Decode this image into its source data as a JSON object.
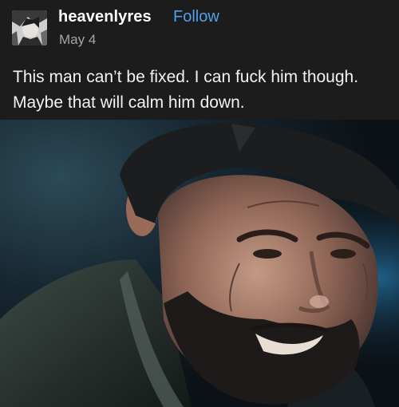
{
  "post": {
    "author": {
      "username": "heavenlyres",
      "follow_label": "Follow",
      "date": "May 4",
      "avatar_icon": "user-avatar"
    },
    "caption_lines": [
      "This man can’t be fixed. I can fuck him though.",
      "Maybe that will calm him down."
    ],
    "image": {
      "subject": "photo-of-bearded-man"
    },
    "colors": {
      "background": "#1c1c1c",
      "link": "#4ea0e8",
      "date": "#a5a5a5",
      "text": "#f2f2f2"
    }
  }
}
